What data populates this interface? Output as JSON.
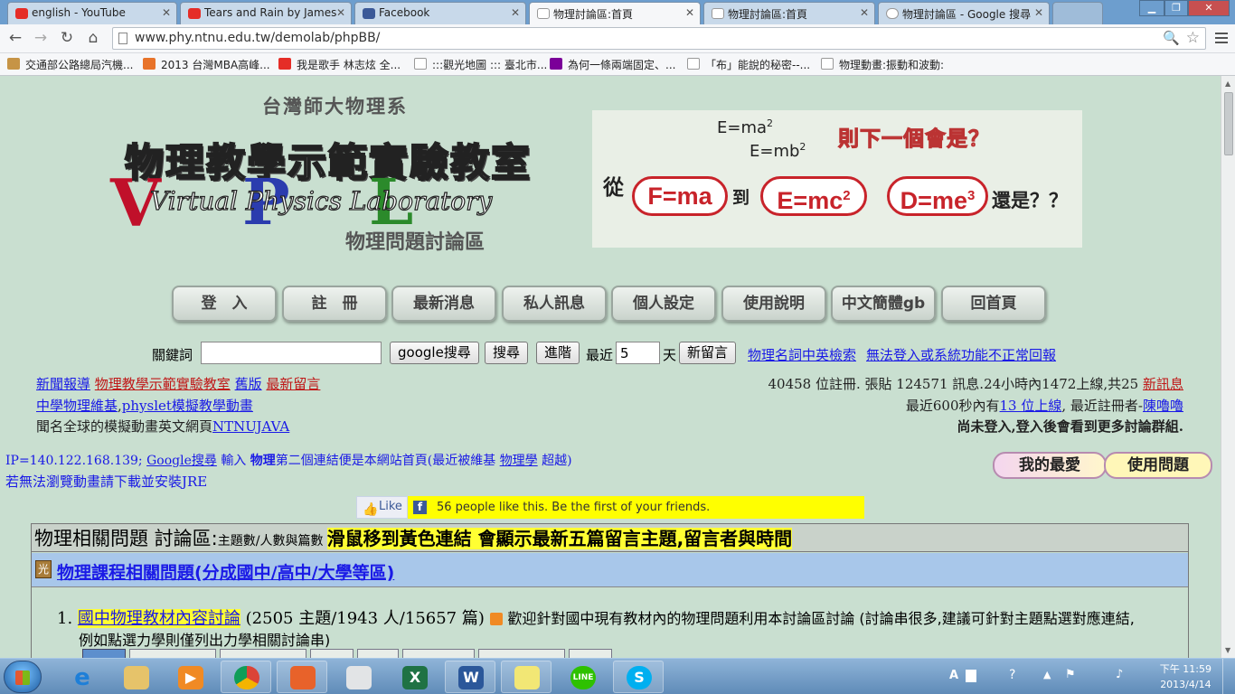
{
  "browser": {
    "tabs": [
      {
        "title": "english - YouTube",
        "icon_color": "#e52d27"
      },
      {
        "title": "Tears and Rain by James",
        "icon_color": "#e52d27"
      },
      {
        "title": "Facebook",
        "icon_color": "#3b5998"
      },
      {
        "title": "物理討論區:首頁",
        "icon_color": "#ffffff"
      },
      {
        "title": "物理討論區:首頁",
        "icon_color": "#ffffff"
      },
      {
        "title": "物理討論區 - Google 搜尋",
        "icon_color": "#ffffff"
      }
    ],
    "url": "www.phy.ntnu.edu.tw/demolab/phpBB/",
    "bookmarks": [
      {
        "label": "交通部公路總局汽機...",
        "icon_color": "#c69446"
      },
      {
        "label": "2013 台灣MBA高峰...",
        "icon_color": "#e8732a"
      },
      {
        "label": "我是歌手 林志炫 全...",
        "icon_color": "#e52d27"
      },
      {
        "label": ":::觀光地圖 ::: 臺北市...",
        "icon_color": "#ffffff"
      },
      {
        "label": "為何一條兩端固定、...",
        "icon_color": "#7b0099"
      },
      {
        "label": "「布」能說的秘密--...",
        "icon_color": "#ffffff"
      },
      {
        "label": "物理動畫:振動和波動:",
        "icon_color": "#ffffff"
      }
    ]
  },
  "banner": {
    "dept": "台灣師大物理系",
    "lab_title": "物理教學示範實驗教室",
    "lab_en": "Virtual Physics Laboratory",
    "forum_sub": "物理問題討論區",
    "eq1": "E=ma",
    "eq2": "E=mb",
    "slogan": "則下一個會是？",
    "from": "從",
    "to": "到",
    "or_q": "還是？？",
    "box1": "F=ma",
    "box2": "E=mc",
    "box3": "D=me",
    "sup1": "2",
    "sup2": "2",
    "sup3": "3",
    "sup4": "3"
  },
  "nav": [
    "登　入",
    "註　冊",
    "最新消息",
    "私人訊息",
    "個人設定",
    "使用說明",
    "中文簡體gb",
    "回首頁"
  ],
  "search": {
    "keyword_label": "關鍵詞",
    "google_btn": "google搜尋",
    "search_btn": "搜尋",
    "advanced_btn": "進階",
    "recent_label": "最近",
    "days_value": "5",
    "days_label": "天",
    "new_posts_btn": "新留言",
    "link1": "物理名詞中英檢索",
    "link2": "無法登入或系統功能不正常回報"
  },
  "links_left": {
    "l1a": "新聞報導",
    "l1b": "物理教學示範實驗教室",
    "l1c": "舊版",
    "l1d": "最新留言",
    "l2a": "中學物理維基",
    "l2b": "physlet模擬教學動畫",
    "l3a": "聞名全球的模擬動畫英文網頁",
    "l3b": "NTNUJAVA"
  },
  "stats": {
    "s1": "40458 位註冊. 張貼 124571 訊息.24小時內1472上線,共25",
    "s1link": "新訊息",
    "s2a": "最近600秒內有",
    "s2link": "13 位上線",
    "s2b": ", 最近註冊者-",
    "s2user": "陳嚕嚕",
    "s3": "尚未登入,登入後會看到更多討論群組."
  },
  "info": {
    "ip": "IP=140.122.168.139;",
    "google": "Google搜尋",
    "input": "輸入",
    "physics": "物理",
    "desc": "第二個連結便是本網站首頁(最近被維基",
    "wiki": "物理學",
    "beyond": "超越)",
    "jre": "若無法瀏覽動畫請下載並安裝JRE"
  },
  "fav": {
    "favorites": "我的最愛",
    "usage": "使用問題"
  },
  "facebook": {
    "like": "Like",
    "text": "56 people like this. Be the first of your friends."
  },
  "forum": {
    "head_title": "物理相關問題 討論區:",
    "head_small": "主題數/人數與篇數",
    "head_highlight": "滑鼠移到黃色連結 會顯示最新五篇留言主題,留言者與時間",
    "category": "物理課程相關問題(分成國中/高中/大學等區)",
    "item_num": "1.",
    "item_title": "國中物理教材內容討論",
    "item_stats": "(2505 主題/1943 人/15657 篇)",
    "item_desc": "歡迎針對國中現有教材內的物理問題利用本討論區討論 (討論串很多,建議可針對主題點選對應連結,",
    "item_desc2": "例如點選力學則僅列出力學相關討論串)"
  },
  "taskbar": {
    "time": "下午 11:59",
    "date": "2013/4/14",
    "lang": "A"
  }
}
